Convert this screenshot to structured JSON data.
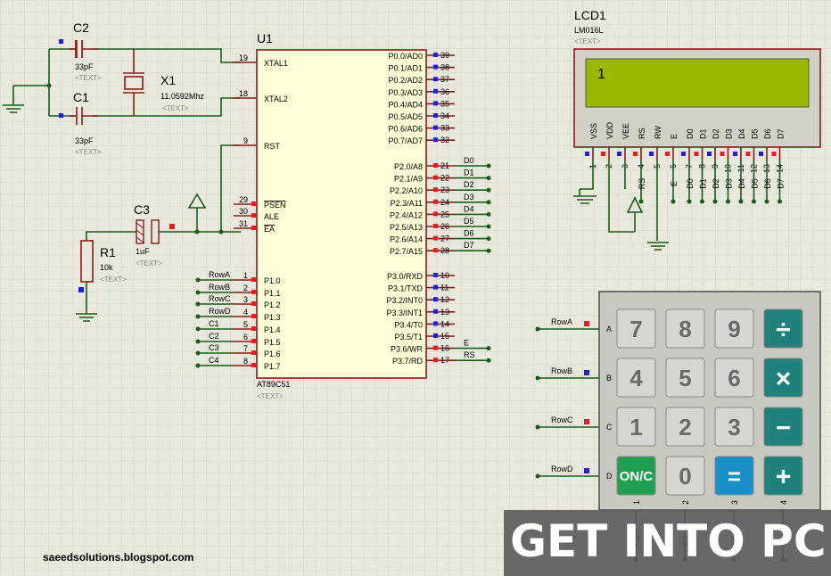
{
  "colors": {
    "grid": "#cfd0c0",
    "background": "#e8e8dc",
    "wire": "#1a5c1a",
    "pin": "#8b1a1a",
    "chip_fill": "#ffffd8",
    "lcd_screen": "#9ab800",
    "key_gray": "#d6d6d0",
    "key_teal": "#20807a",
    "key_blue": "#1a8fc8",
    "key_green": "#20a050",
    "pin_blue": "#2020d0",
    "pin_red": "#e02020"
  },
  "components": {
    "c2": {
      "ref": "C2",
      "value": "33pF",
      "text": "<TEXT>"
    },
    "c1": {
      "ref": "C1",
      "value": "33pF",
      "text": "<TEXT>"
    },
    "x1": {
      "ref": "X1",
      "value": "11.0592Mhz",
      "text": "<TEXT>"
    },
    "c3": {
      "ref": "C3",
      "value": "1uF",
      "text": "<TEXT>"
    },
    "r1": {
      "ref": "R1",
      "value": "10k",
      "text": "<TEXT>"
    },
    "u1": {
      "ref": "U1",
      "part": "AT89C51",
      "text": "<TEXT>"
    },
    "lcd1": {
      "ref": "LCD1",
      "part": "LM016L",
      "text": "<TEXT>",
      "screen_text": "1"
    }
  },
  "u1_left_pins": [
    {
      "num": "19",
      "name": "XTAL1"
    },
    {
      "num": "18",
      "name": "XTAL2"
    },
    {
      "num": "9",
      "name": "RST"
    },
    {
      "num": "29",
      "name": "PSEN"
    },
    {
      "num": "30",
      "name": "ALE"
    },
    {
      "num": "31",
      "name": "EA"
    },
    {
      "num": "1",
      "name": "P1.0",
      "net": "RowA"
    },
    {
      "num": "2",
      "name": "P1.1",
      "net": "RowB"
    },
    {
      "num": "3",
      "name": "P1.2",
      "net": "RowC"
    },
    {
      "num": "4",
      "name": "P1.3",
      "net": "RowD"
    },
    {
      "num": "5",
      "name": "P1.4",
      "net": "C1"
    },
    {
      "num": "6",
      "name": "P1.5",
      "net": "C2"
    },
    {
      "num": "7",
      "name": "P1.6",
      "net": "C3"
    },
    {
      "num": "8",
      "name": "P1.7",
      "net": "C4"
    }
  ],
  "u1_right_pins": [
    {
      "num": "39",
      "name": "P0.0/AD0"
    },
    {
      "num": "38",
      "name": "P0.1/AD1"
    },
    {
      "num": "37",
      "name": "P0.2/AD2"
    },
    {
      "num": "36",
      "name": "P0.3/AD3"
    },
    {
      "num": "35",
      "name": "P0.4/AD4"
    },
    {
      "num": "34",
      "name": "P0.5/AD5"
    },
    {
      "num": "33",
      "name": "P0.6/AD6"
    },
    {
      "num": "32",
      "name": "P0.7/AD7"
    },
    {
      "num": "21",
      "name": "P2.0/A8",
      "net": "D0"
    },
    {
      "num": "22",
      "name": "P2.1/A9",
      "net": "D1"
    },
    {
      "num": "23",
      "name": "P2.2/A10",
      "net": "D2"
    },
    {
      "num": "24",
      "name": "P2.3/A11",
      "net": "D3"
    },
    {
      "num": "25",
      "name": "P2.4/A12",
      "net": "D4"
    },
    {
      "num": "26",
      "name": "P2.5/A13",
      "net": "D5"
    },
    {
      "num": "27",
      "name": "P2.6/A14",
      "net": "D6"
    },
    {
      "num": "28",
      "name": "P2.7/A15",
      "net": "D7"
    },
    {
      "num": "10",
      "name": "P3.0/RXD"
    },
    {
      "num": "11",
      "name": "P3.1/TXD"
    },
    {
      "num": "12",
      "name": "P3.2/INT0"
    },
    {
      "num": "13",
      "name": "P3.3/INT1"
    },
    {
      "num": "14",
      "name": "P3.4/T0"
    },
    {
      "num": "15",
      "name": "P3.5/T1"
    },
    {
      "num": "16",
      "name": "P3.6/WR",
      "net": "E"
    },
    {
      "num": "17",
      "name": "P3.7/RD",
      "net": "RS"
    }
  ],
  "lcd_pins": [
    {
      "num": "1",
      "name": "VSS"
    },
    {
      "num": "2",
      "name": "VDD"
    },
    {
      "num": "3",
      "name": "VEE"
    },
    {
      "num": "4",
      "name": "RS",
      "net": "RS"
    },
    {
      "num": "5",
      "name": "RW"
    },
    {
      "num": "6",
      "name": "E",
      "net": "E"
    },
    {
      "num": "7",
      "name": "D0",
      "net": "D0"
    },
    {
      "num": "8",
      "name": "D1",
      "net": "D1"
    },
    {
      "num": "9",
      "name": "D2",
      "net": "D2"
    },
    {
      "num": "10",
      "name": "D3",
      "net": "D3"
    },
    {
      "num": "11",
      "name": "D4",
      "net": "D4"
    },
    {
      "num": "12",
      "name": "D5",
      "net": "D5"
    },
    {
      "num": "13",
      "name": "D6",
      "net": "D6"
    },
    {
      "num": "14",
      "name": "D7",
      "net": "D7"
    }
  ],
  "keypad": {
    "rows": [
      {
        "net": "RowA",
        "letter": "A"
      },
      {
        "net": "RowB",
        "letter": "B"
      },
      {
        "net": "RowC",
        "letter": "C"
      },
      {
        "net": "RowD",
        "letter": "D"
      }
    ],
    "cols": [
      {
        "num": "1",
        "net": "C1"
      },
      {
        "num": "2",
        "net": "C2"
      },
      {
        "num": "3",
        "net": "C3"
      },
      {
        "num": "4",
        "net": "C4"
      }
    ],
    "keys": [
      [
        "7",
        "8",
        "9",
        "÷"
      ],
      [
        "4",
        "5",
        "6",
        "×"
      ],
      [
        "1",
        "2",
        "3",
        "−"
      ],
      [
        "ON/C",
        "0",
        "=",
        "+"
      ]
    ]
  },
  "watermark": "GET INTO PC",
  "footer": "saeedsolutions.blogspot.com"
}
